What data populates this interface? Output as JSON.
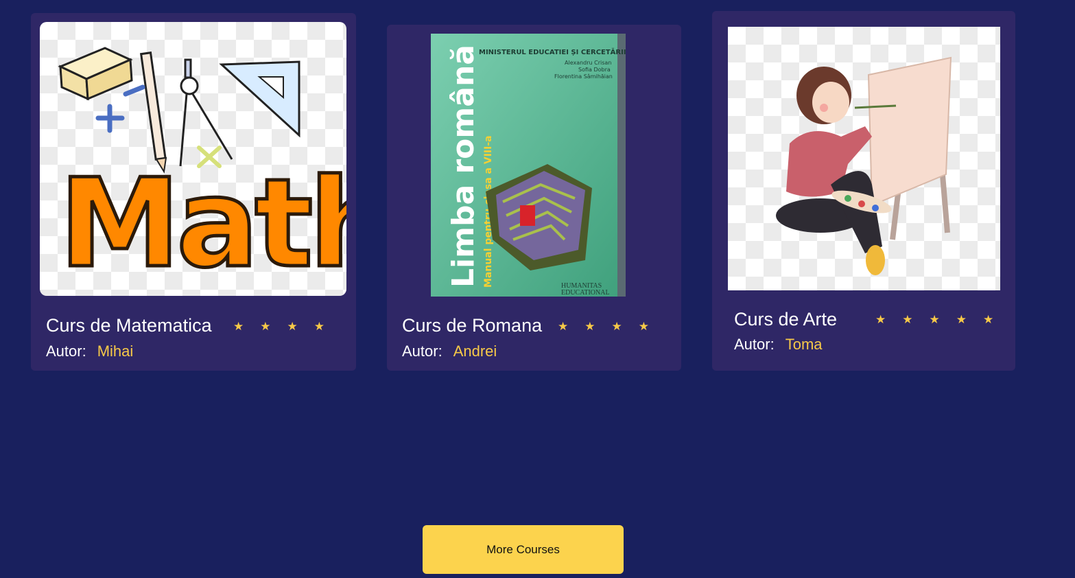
{
  "courses": [
    {
      "title": "Curs de Matematica",
      "author_label": "Autor:",
      "author": "Mihai",
      "stars": 4,
      "image_word": "Math"
    },
    {
      "title": "Curs de Romana",
      "author_label": "Autor:",
      "author": "Andrei",
      "stars": 4,
      "book": {
        "ministry": "MINISTERUL EDUCATIEI ȘI CERCETĂRII",
        "authors": [
          "Alexandru Crisan",
          "Sofia Dobra",
          "Florentina Sâmihăian"
        ],
        "title": "Limba română",
        "subtitle": "Manual pentru clasa a VIII-a",
        "publisher_line1": "HUMANITAS",
        "publisher_line2": "EDUCATIONAL"
      }
    },
    {
      "title": "Curs de Arte",
      "author_label": "Autor:",
      "author": "Toma",
      "stars": 5
    }
  ],
  "more_button": "More Courses",
  "colors": {
    "background": "#19205e",
    "card": "#2f2766",
    "accent": "#f7c948",
    "button": "#fcd34d"
  }
}
